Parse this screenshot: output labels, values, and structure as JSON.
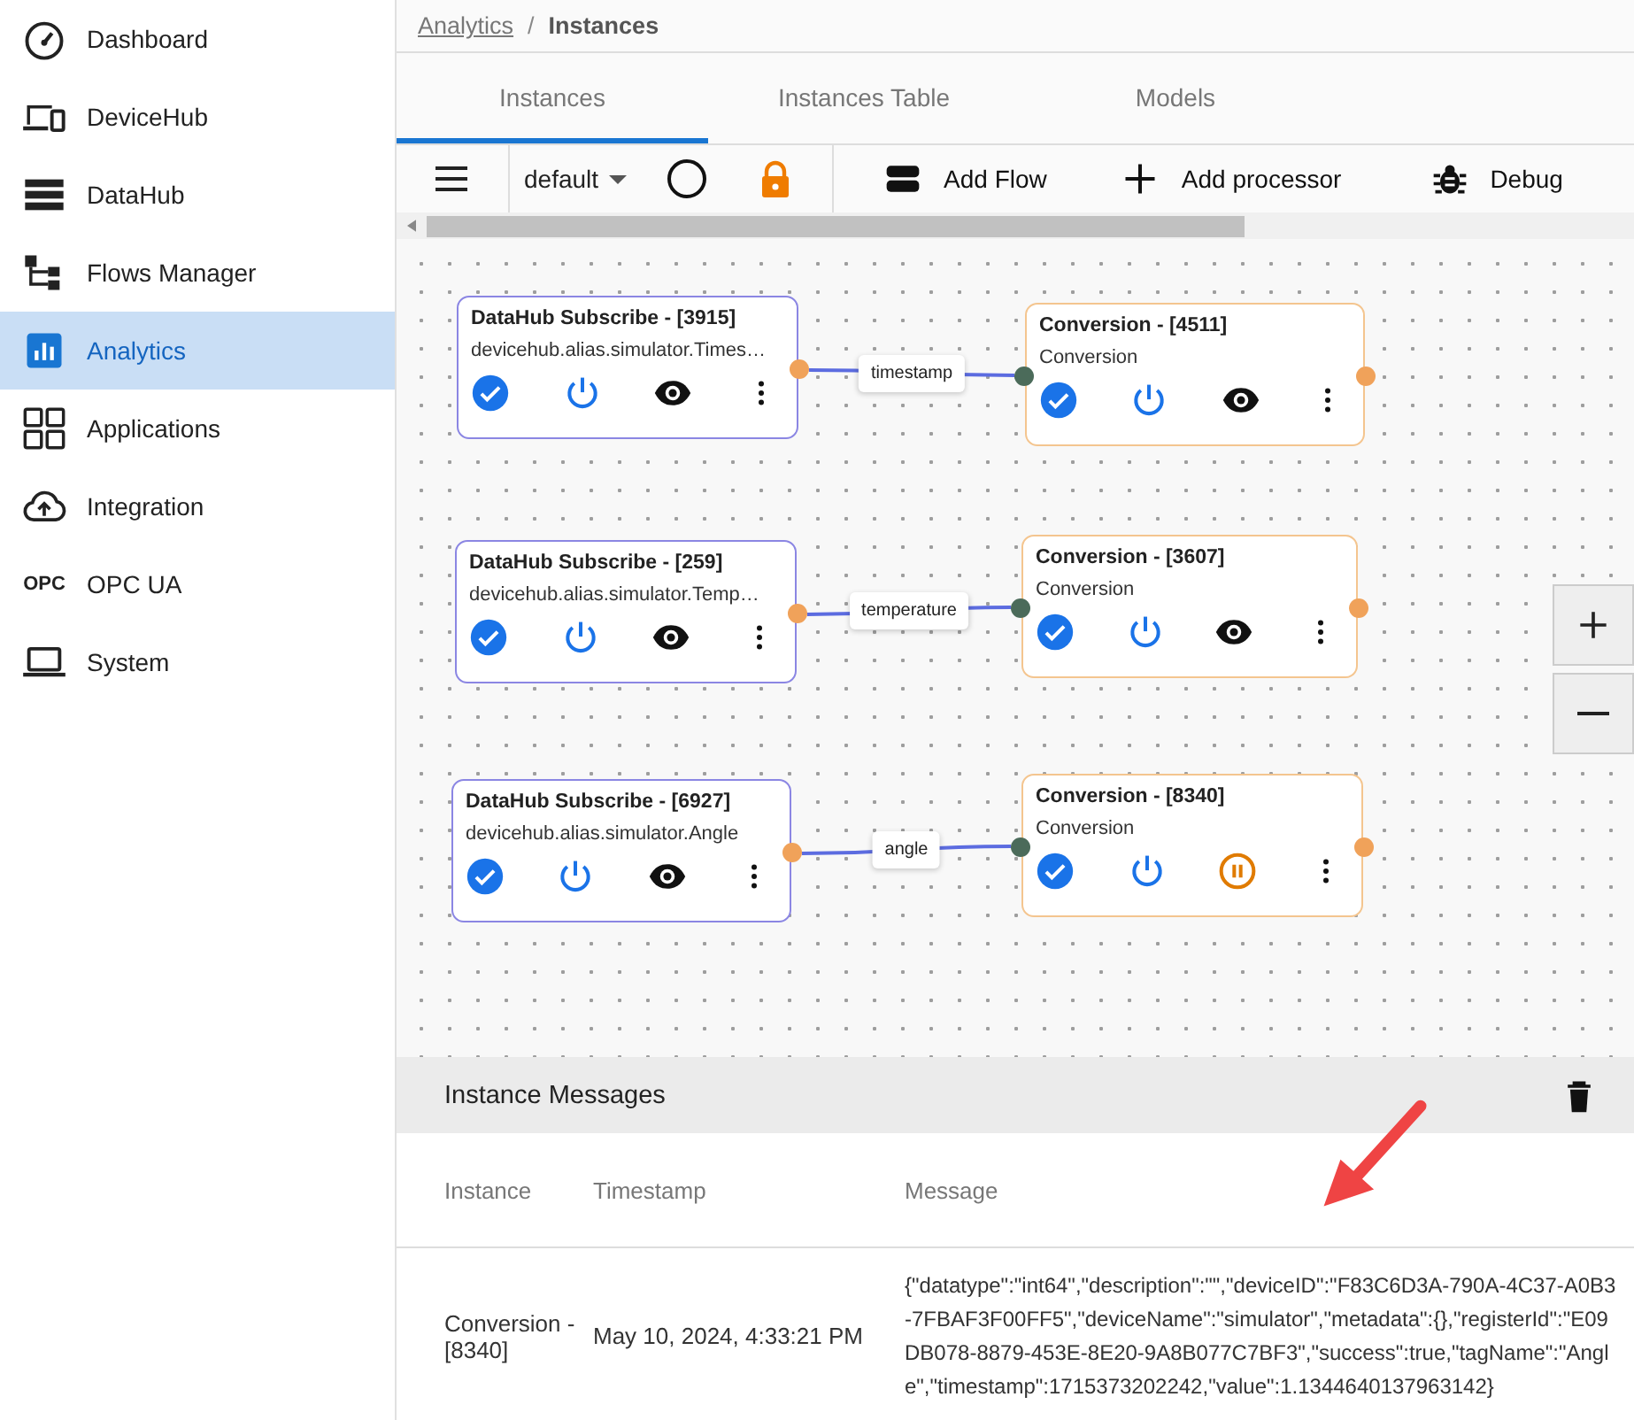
{
  "sidebar": {
    "items": [
      {
        "label": "Dashboard",
        "kind": "gauge",
        "selected": false
      },
      {
        "label": "DeviceHub",
        "kind": "devices",
        "selected": false
      },
      {
        "label": "DataHub",
        "kind": "storage",
        "selected": false
      },
      {
        "label": "Flows Manager",
        "kind": "flow",
        "selected": false
      },
      {
        "label": "Analytics",
        "kind": "chart",
        "selected": true
      },
      {
        "label": "Applications",
        "kind": "grid",
        "selected": false
      },
      {
        "label": "Integration",
        "kind": "cloud",
        "selected": false
      },
      {
        "label": "OPC UA",
        "kind": "badge",
        "badge": "OPC",
        "selected": false
      },
      {
        "label": "System",
        "kind": "laptop",
        "selected": false
      }
    ]
  },
  "breadcrumb": {
    "link": "Analytics",
    "separator": "/",
    "current": "Instances"
  },
  "tabs": [
    {
      "label": "Instances",
      "selected": true
    },
    {
      "label": "Instances Table",
      "selected": false
    },
    {
      "label": "Models",
      "selected": false
    }
  ],
  "toolbar": {
    "flow_select": "default",
    "buttons": [
      {
        "label": "Add Flow",
        "kind": "flow"
      },
      {
        "label": "Add processor",
        "kind": "add"
      },
      {
        "label": "Debug",
        "kind": "debug"
      }
    ]
  },
  "canvas": {
    "nodes": [
      {
        "title": "DataHub Subscribe - [3915]",
        "subtitle": "devicehub.alias.simulator.Times…",
        "kind": "subscribe",
        "checked": true,
        "paused": false
      },
      {
        "title": "Conversion - [4511]",
        "subtitle": "Conversion",
        "kind": "conversion",
        "checked": true,
        "paused": false
      },
      {
        "title": "DataHub Subscribe - [259]",
        "subtitle": "devicehub.alias.simulator.Temp…",
        "kind": "subscribe",
        "checked": true,
        "paused": false
      },
      {
        "title": "Conversion - [3607]",
        "subtitle": "Conversion",
        "kind": "conversion",
        "checked": true,
        "paused": false
      },
      {
        "title": "DataHub Subscribe - [6927]",
        "subtitle": "devicehub.alias.simulator.Angle",
        "kind": "subscribe",
        "checked": true,
        "paused": false
      },
      {
        "title": "Conversion - [8340]",
        "subtitle": "Conversion",
        "kind": "conversion",
        "checked": true,
        "paused": true
      }
    ],
    "edges": [
      {
        "label": "timestamp"
      },
      {
        "label": "temperature"
      },
      {
        "label": "angle"
      }
    ]
  },
  "messages": {
    "title": "Instance Messages",
    "columns": [
      "Instance",
      "Timestamp",
      "Message"
    ],
    "rows": [
      {
        "instance": "Conversion - [8340]",
        "timestamp": "May 10, 2024, 4:33:21 PM",
        "message": "{\"datatype\":\"int64\",\"description\":\"\",\"deviceID\":\"F83C6D3A-790A-4C37-A0B3-7FBAF3F00FF5\",\"deviceName\":\"simulator\",\"metadata\":{},\"registerId\":\"E09DB078-8879-453E-8E20-9A8B077C7BF3\",\"success\":true,\"tagName\":\"Angle\",\"timestamp\":1715373202242,\"value\":1.1344640137963142}"
      }
    ]
  }
}
